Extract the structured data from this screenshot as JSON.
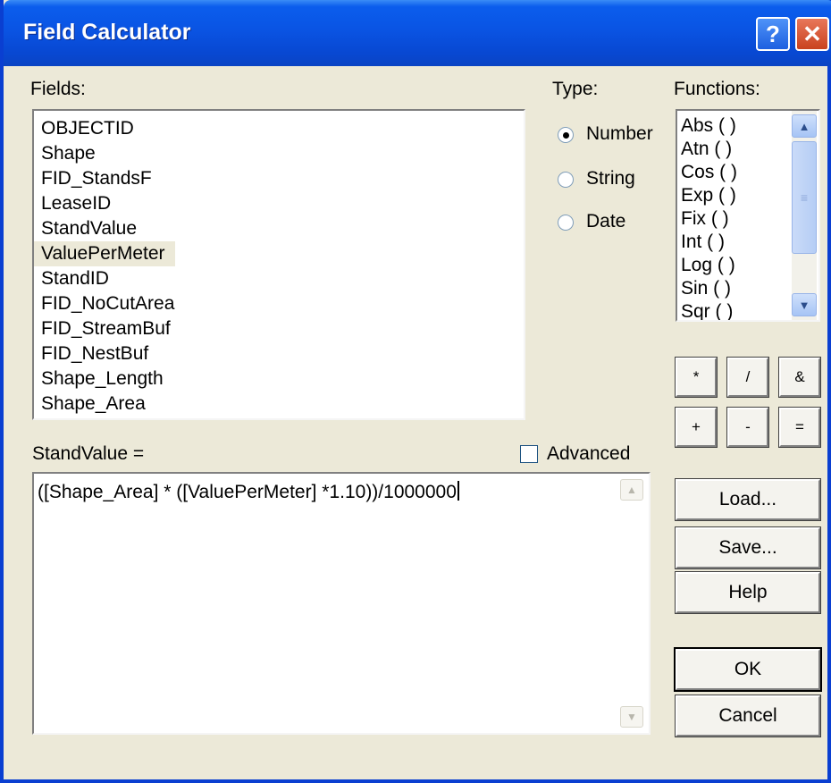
{
  "window": {
    "title": "Field Calculator"
  },
  "titlebar": {
    "help_glyph": "?",
    "close_glyph": "✕"
  },
  "fields": {
    "label": "Fields:",
    "items": [
      "OBJECTID",
      "Shape",
      "FID_StandsF",
      "LeaseID",
      "StandValue",
      "ValuePerMeter",
      "StandID",
      "FID_NoCutArea",
      "FID_StreamBuf",
      "FID_NestBuf",
      "Shape_Length",
      "Shape_Area"
    ],
    "selected": "ValuePerMeter"
  },
  "type": {
    "label": "Type:",
    "options": [
      "Number",
      "String",
      "Date"
    ],
    "selected": "Number"
  },
  "functions": {
    "label": "Functions:",
    "items": [
      "Abs ( )",
      "Atn ( )",
      "Cos ( )",
      "Exp ( )",
      "Fix ( )",
      "Int ( )",
      "Log ( )",
      "Sin ( )",
      "Sqr ( )"
    ]
  },
  "operators": [
    "*",
    "/",
    "&",
    "+",
    "-",
    "="
  ],
  "expression": {
    "label": "StandValue =",
    "value": "([Shape_Area] * ([ValuePerMeter] *1.10))/1000000"
  },
  "advanced": {
    "label": "Advanced",
    "checked": false
  },
  "buttons": {
    "load": "Load...",
    "save": "Save...",
    "help": "Help",
    "ok": "OK",
    "cancel": "Cancel"
  },
  "icons": {
    "scroll_up": "chevron-up-icon",
    "scroll_down": "chevron-down-icon"
  }
}
